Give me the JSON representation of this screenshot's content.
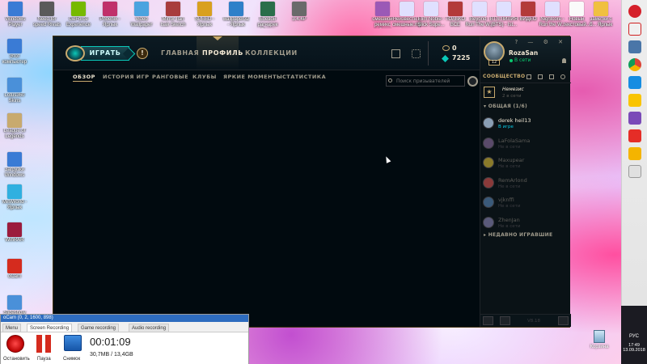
{
  "desktop": {
    "top_icons": [
      {
        "label": "Windows Player",
        "color": "#3a7bd5"
      },
      {
        "label": "Need for speed Rivals",
        "color": "#5a5a5a"
      },
      {
        "label": "GeForce Experience",
        "color": "#76b900"
      },
      {
        "label": "Phoenix - Ярлык",
        "color": "#c0306a"
      },
      {
        "label": "Video Wallpaper",
        "color": "#4aa3df"
      },
      {
        "label": "Mirror Ilan Isak Sketch",
        "color": "#a83c3c"
      },
      {
        "label": "SPEED - Ярлык",
        "color": "#d9a01e"
      },
      {
        "label": "wallpaper32 - Ярлык",
        "color": "#2f80c9"
      },
      {
        "label": "Боевой рагнарек Ярлык",
        "color": "#2a6e4a"
      },
      {
        "label": "3.4.4P",
        "color": "#6a6a6a"
      }
    ],
    "top_right_icons": [
      {
        "label": "смешной ремикс дубстеп",
        "color": "#9b59b6"
      },
      {
        "label": "Неизвестн... смешные.mp3",
        "color": "#e0e0ff"
      },
      {
        "label": "Elim Noble - Slick Supe...",
        "color": "#e0e0ff"
      },
      {
        "label": "ТОЛЬКО ВСЕ",
        "color": "#b33a3a"
      },
      {
        "label": "Beyond - Run The W...",
        "color": "#e0e0ff"
      },
      {
        "label": "BTS ЛИЛИЯ (BTS) - Ist...",
        "color": "#e0e0ff"
      },
      {
        "label": "ВИДЕО",
        "color": "#b33a3a"
      },
      {
        "label": "Nightcore - Run the W...",
        "color": "#e0e0ff"
      },
      {
        "label": "Новый текстовый...",
        "color": "#fafafa"
      },
      {
        "label": "заметки с б... Ярлык",
        "color": "#f0c040"
      }
    ],
    "left_icons": [
      {
        "label": "Этот компьютер",
        "color": "#3a7bd5"
      },
      {
        "label": "Lotus360 Skins",
        "color": "#4a90d9"
      },
      {
        "label": "League of Legends",
        "color": "#c8aa6e"
      },
      {
        "label": "Загрузки Windows",
        "color": "#3a7bd5"
      },
      {
        "label": "MiniWorld - Ярлык",
        "color": "#30b0e0"
      },
      {
        "label": "WinRAR",
        "color": "#9b1c3d"
      },
      {
        "label": "oCam",
        "color": "#d52b1e"
      },
      {
        "label": "Slideshow",
        "color": "#4a90d9"
      }
    ],
    "recycle_bin": "Корзина"
  },
  "client": {
    "play_label": "ИГРАТЬ",
    "gold_symbol": "!",
    "nav": {
      "home": "ГЛАВНАЯ",
      "profile": "ПРОФИЛЬ",
      "collection": "КОЛЛЕКЦИИ"
    },
    "currency": {
      "rp": "0",
      "be": "7225"
    },
    "subnav": [
      "ОБЗОР",
      "ИСТОРИЯ ИГР",
      "РАНГОВЫЕ",
      "КЛУБЫ",
      "ЯРКИЕ МОМЕНТЫ",
      "СТАТИСТИКА"
    ],
    "search_placeholder": "Поиск призывателей"
  },
  "social": {
    "window_controls": "? — ⚙ ✕",
    "summoner": {
      "name": "RozaSan",
      "level": "12",
      "status": "В сети"
    },
    "community_label": "СООБЩЕСТВО",
    "nemesis": {
      "name": "Немезис",
      "status": "2 в сети"
    },
    "group_header": "▾ ОБЩАЯ (1/6)",
    "friends": [
      {
        "name": "derek heil13",
        "status": "В игре",
        "online": true,
        "color": "#8a9fb5"
      },
      {
        "name": "LaFolaSama",
        "status": "Не в сети",
        "online": false,
        "color": "#5a4a6a"
      },
      {
        "name": "Maxupear",
        "status": "Не в сети",
        "online": false,
        "color": "#8a7a2a"
      },
      {
        "name": "RemArlond",
        "status": "Не в сети",
        "online": false,
        "color": "#8a3a3a"
      },
      {
        "name": "vjknffi",
        "status": "Не в сети",
        "online": false,
        "color": "#3a5a7a"
      },
      {
        "name": "ZhenJan",
        "status": "Не в сети",
        "online": false,
        "color": "#5a5a7a"
      }
    ],
    "recent_header": "▸ НЕДАВНО ИГРАВШИЕ",
    "version": "V8.18"
  },
  "ocam": {
    "title": "oCam (0, 2, 1600, 898)",
    "tabs": [
      "Menu",
      "Screen Recording",
      "Game recording",
      "Audio recording"
    ],
    "buttons": {
      "record": "Остановить",
      "pause": "Пауза",
      "snapshot": "Снимок"
    },
    "time": "00:01:09",
    "size": "30,7MB / 13,4GB"
  },
  "tray": {
    "lang": "РУС",
    "time": "17:49",
    "date": "13.09.2018"
  },
  "colors": {
    "lol_gold": "#c8aa6e",
    "lol_teal": "#0ac8b9",
    "bg_dark": "#010a0f",
    "online_green": "#0acb6e"
  }
}
